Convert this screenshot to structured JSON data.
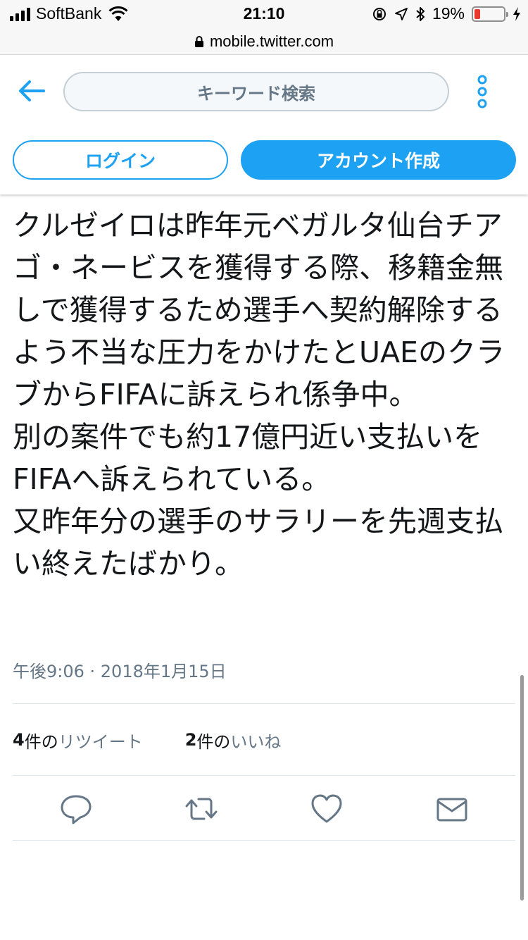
{
  "status_bar": {
    "carrier": "SoftBank",
    "time": "21:10",
    "battery_percent": "19%",
    "battery_level": 0.19
  },
  "browser": {
    "url": "mobile.twitter.com"
  },
  "header": {
    "search_placeholder": "キーワード検索",
    "login_label": "ログイン",
    "signup_label": "アカウント作成"
  },
  "tweet": {
    "text": "クルゼイロは昨年元ベガルタ仙台チアゴ・ネービスを獲得する際、移籍金無しで獲得するため選手へ契約解除するよう不当な圧力をかけたとUAEのクラブからFIFAに訴えられ係争中。\n別の案件でも約17億円近い支払いをFIFAへ訴えられている。\n又昨年分の選手のサラリーを先週支払い終えたばかり。",
    "timestamp": "午後9:06 · 2018年1月15日",
    "retweets": {
      "count": "4",
      "unit": "件の",
      "label": "リツイート"
    },
    "likes": {
      "count": "2",
      "unit": "件の",
      "label": "いいね"
    }
  },
  "icons": {
    "back": "arrow-left-icon",
    "more": "vertical-dots-icon",
    "reply": "reply-icon",
    "retweet": "retweet-icon",
    "like": "heart-icon",
    "share": "envelope-icon"
  },
  "colors": {
    "accent": "#1da1f2",
    "text": "#14171a",
    "secondary": "#657786",
    "battery_low": "#e8392c"
  }
}
